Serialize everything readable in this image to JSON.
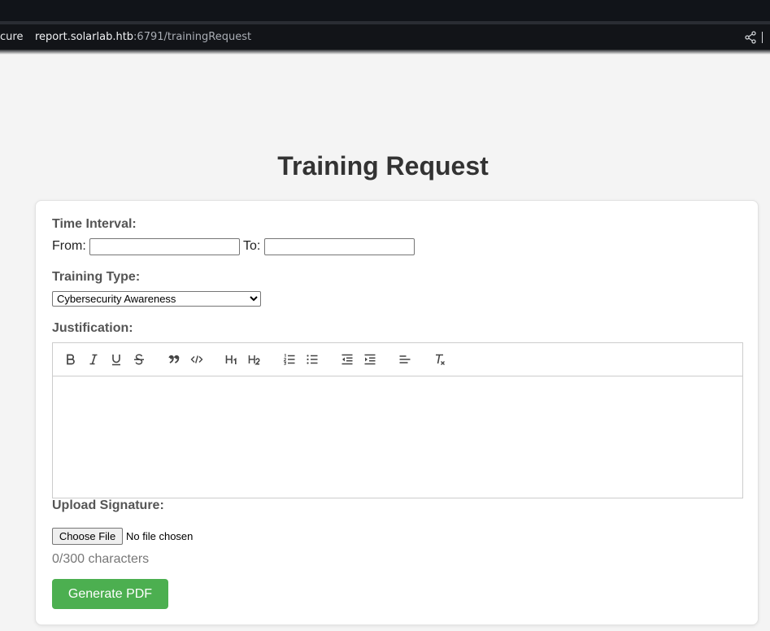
{
  "browser": {
    "scheme_fragment": "cure",
    "url_host": "report.solarlab.htb",
    "url_path": ":6791/trainingRequest"
  },
  "page": {
    "title": "Training Request"
  },
  "form": {
    "time_interval_label": "Time Interval:",
    "from_label": "From:",
    "from_value": "",
    "to_label": "To:",
    "to_value": "",
    "training_type_label": "Training Type:",
    "training_type_selected": "Cybersecurity Awareness",
    "justification_label": "Justification:",
    "toolbar_icons": [
      "bold-icon",
      "italic-icon",
      "underline-icon",
      "strike-icon",
      "blockquote-icon",
      "code-block-icon",
      "header-1-icon",
      "header-2-icon",
      "ordered-list-icon",
      "bullet-list-icon",
      "outdent-icon",
      "indent-icon",
      "align-icon",
      "clear-format-icon"
    ],
    "upload_label": "Upload Signature:",
    "choose_file_label": "Choose File",
    "file_status": "No file chosen",
    "char_count": "0/300 characters",
    "generate_button": "Generate PDF"
  },
  "colors": {
    "accent": "#4caf50",
    "page_bg": "#f4f4f4",
    "chrome_bg": "#121418"
  }
}
